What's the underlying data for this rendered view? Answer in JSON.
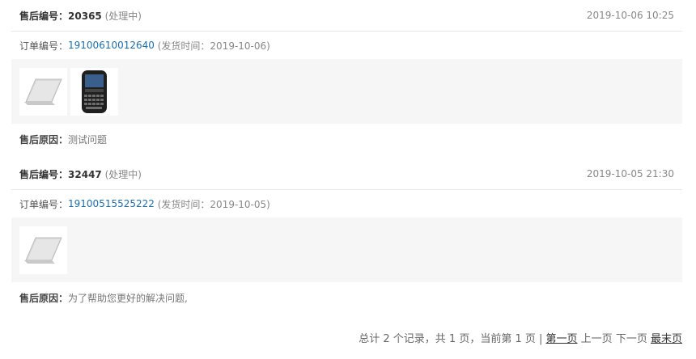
{
  "labels": {
    "aftersale_no": "售后编号：",
    "order_no": "订单编号：",
    "reason": "售后原因："
  },
  "records": [
    {
      "aftersale_id": "20365",
      "status": "(处理中)",
      "datetime": "2019-10-06 10:25",
      "order_id": "19100610012640",
      "ship_info": "(发货时间：2019-10-06)",
      "products": [
        "laptop",
        "phone"
      ],
      "reason": "测试问题"
    },
    {
      "aftersale_id": "32447",
      "status": "(处理中)",
      "datetime": "2019-10-05 21:30",
      "order_id": "19100515525222",
      "ship_info": "(发货时间：2019-10-05)",
      "products": [
        "laptop"
      ],
      "reason": "为了帮助您更好的解决问题,"
    }
  ],
  "pagination": {
    "summary": "总计 2 个记录，共 1 页，当前第 1 页 |",
    "first": "第一页",
    "prev": "上一页",
    "next": "下一页",
    "last": "最末页"
  }
}
